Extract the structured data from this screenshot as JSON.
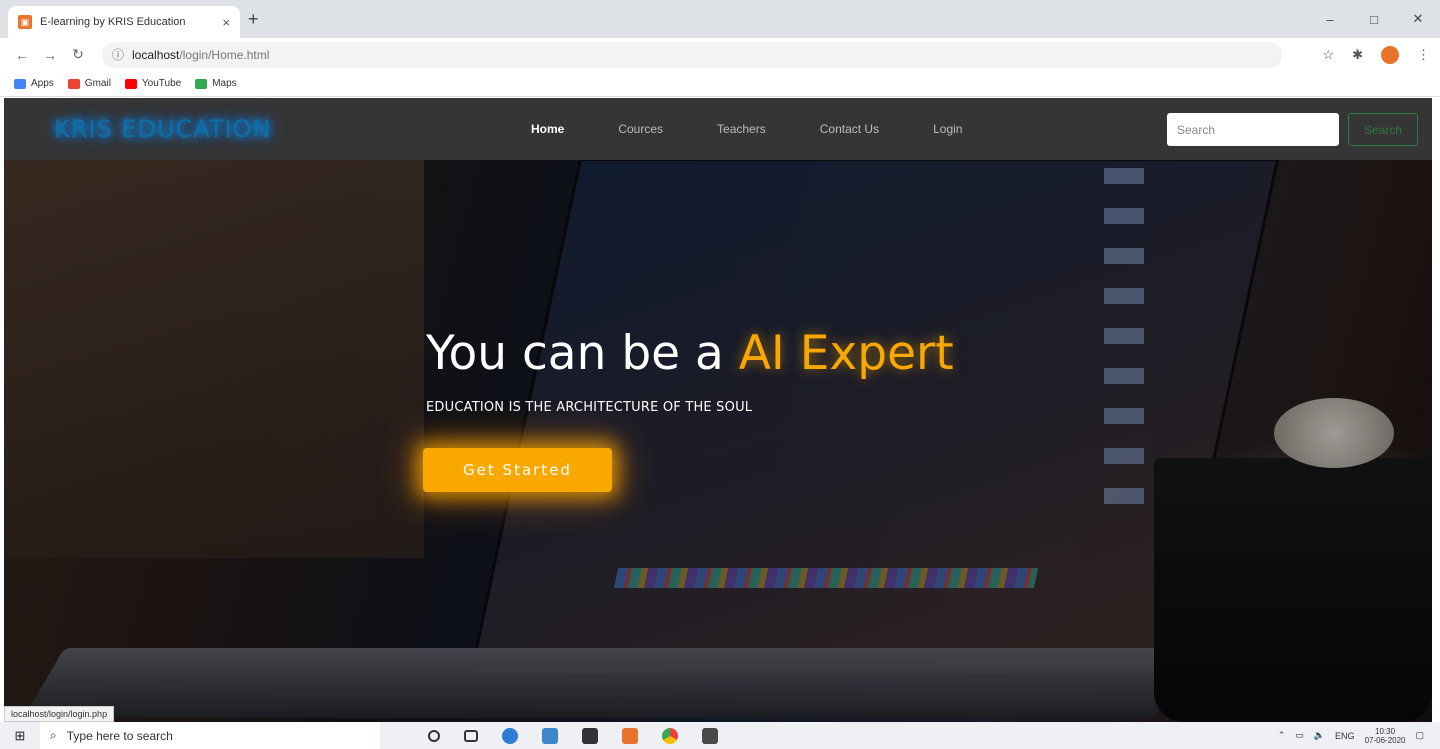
{
  "browser": {
    "tab_title": "E-learning by KRIS Education",
    "tab_close": "×",
    "new_tab": "+",
    "window_controls": [
      "–",
      "□",
      "✕"
    ],
    "url_host": "localhost",
    "url_path": "/login/Home.html",
    "bookmarks": [
      {
        "label": "Apps",
        "color": "#4285f4"
      },
      {
        "label": "Gmail",
        "color": "#ea4335"
      },
      {
        "label": "YouTube",
        "color": "#ff0000"
      },
      {
        "label": "Maps",
        "color": "#34a853"
      }
    ],
    "status_url": "localhost/login/login.php"
  },
  "navbar": {
    "logo": "KRIS EDUCATION",
    "items": [
      "Home",
      "Cources",
      "Teachers",
      "Contact Us",
      "Login"
    ],
    "active_item": "Home",
    "search_placeholder": "Search",
    "search_button": "Search"
  },
  "hero": {
    "headline_prefix": "You can be a ",
    "headline_accent": "AI Expert",
    "subline": "EDUCATION IS THE ARCHITECTURE OF THE SOUL",
    "cta_label": "Get Started",
    "accent_color": "#f9a800"
  },
  "taskbar": {
    "search_placeholder": "Type here to search",
    "tray_lang": "ENG",
    "clock_time": "10:30",
    "clock_date": "07-06-2020"
  }
}
